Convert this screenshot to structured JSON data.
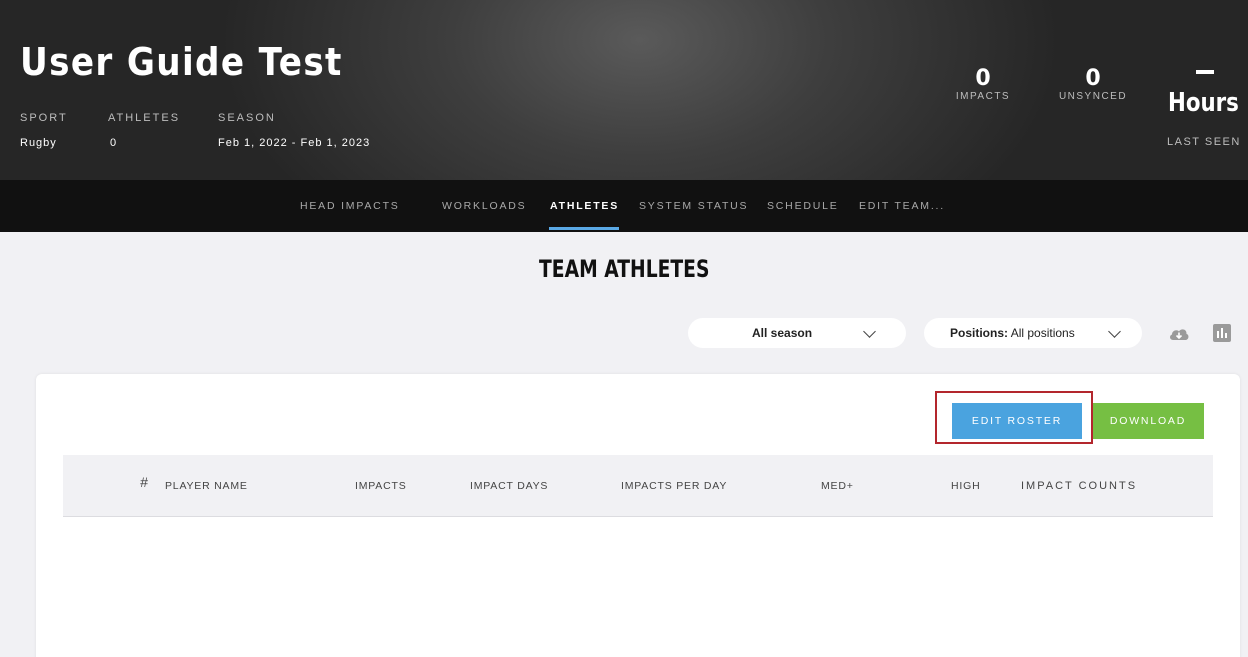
{
  "team": {
    "name": "User Guide Test",
    "sport_label": "SPORT",
    "sport_value": "Rugby",
    "athletes_label": "ATHLETES",
    "athletes_value": "0",
    "season_label": "SEASON",
    "season_value": "Feb 1, 2022 - Feb 1, 2023"
  },
  "stats": {
    "impacts_value": "0",
    "impacts_label": "IMPACTS",
    "unsynced_value": "0",
    "unsynced_label": "UNSYNCED",
    "last_seen_value": "Hours",
    "last_seen_label": "LAST SEEN"
  },
  "nav": {
    "items": [
      {
        "label": "HEAD IMPACTS"
      },
      {
        "label": "WORKLOADS"
      },
      {
        "label": "ATHLETES",
        "active": true
      },
      {
        "label": "SYSTEM STATUS"
      },
      {
        "label": "SCHEDULE"
      },
      {
        "label": "EDIT TEAM..."
      }
    ]
  },
  "main": {
    "title": "TEAM ATHLETES",
    "season_filter": "All season",
    "positions_filter_label": "Positions:",
    "positions_filter_value": "All positions",
    "edit_roster_label": "EDIT ROSTER",
    "download_label": "DOWNLOAD"
  },
  "table": {
    "columns": [
      "#",
      "PLAYER NAME",
      "IMPACTS",
      "IMPACT DAYS",
      "IMPACTS PER DAY",
      "MED+",
      "HIGH",
      "IMPACT COUNTS"
    ],
    "rows": []
  },
  "colors": {
    "accent_blue": "#4aa3df",
    "accent_green": "#76bf43",
    "highlight_red": "#b3262d",
    "nav_bg": "#111111"
  },
  "icons": [
    "cloud-download-icon",
    "chart-icon",
    "chevron-down-icon"
  ]
}
